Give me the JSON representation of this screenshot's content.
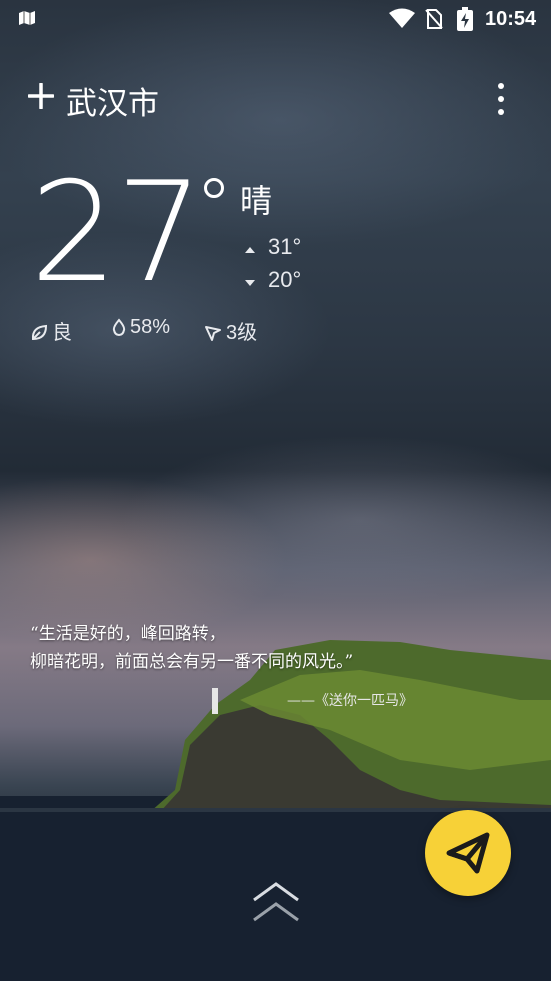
{
  "status_bar": {
    "time": "10:54",
    "icons": [
      "map-icon",
      "wifi-icon",
      "no-sim-icon",
      "battery-charging-icon"
    ]
  },
  "header": {
    "city": "武汉市",
    "add_icon": "plus-icon",
    "menu_icon": "more-vert-icon"
  },
  "weather": {
    "temperature": "27",
    "condition": "晴",
    "high": "31°",
    "low": "20°",
    "air_quality": "良",
    "humidity": "58%",
    "wind": "3级"
  },
  "quote": {
    "line1": "“生活是好的，峰回路转，",
    "line2": "柳暗花明，前面总会有另一番不同的风光。”",
    "attribution": "——《送你一匹马》"
  },
  "colors": {
    "fab": "#f7d137",
    "text": "#ffffff"
  }
}
